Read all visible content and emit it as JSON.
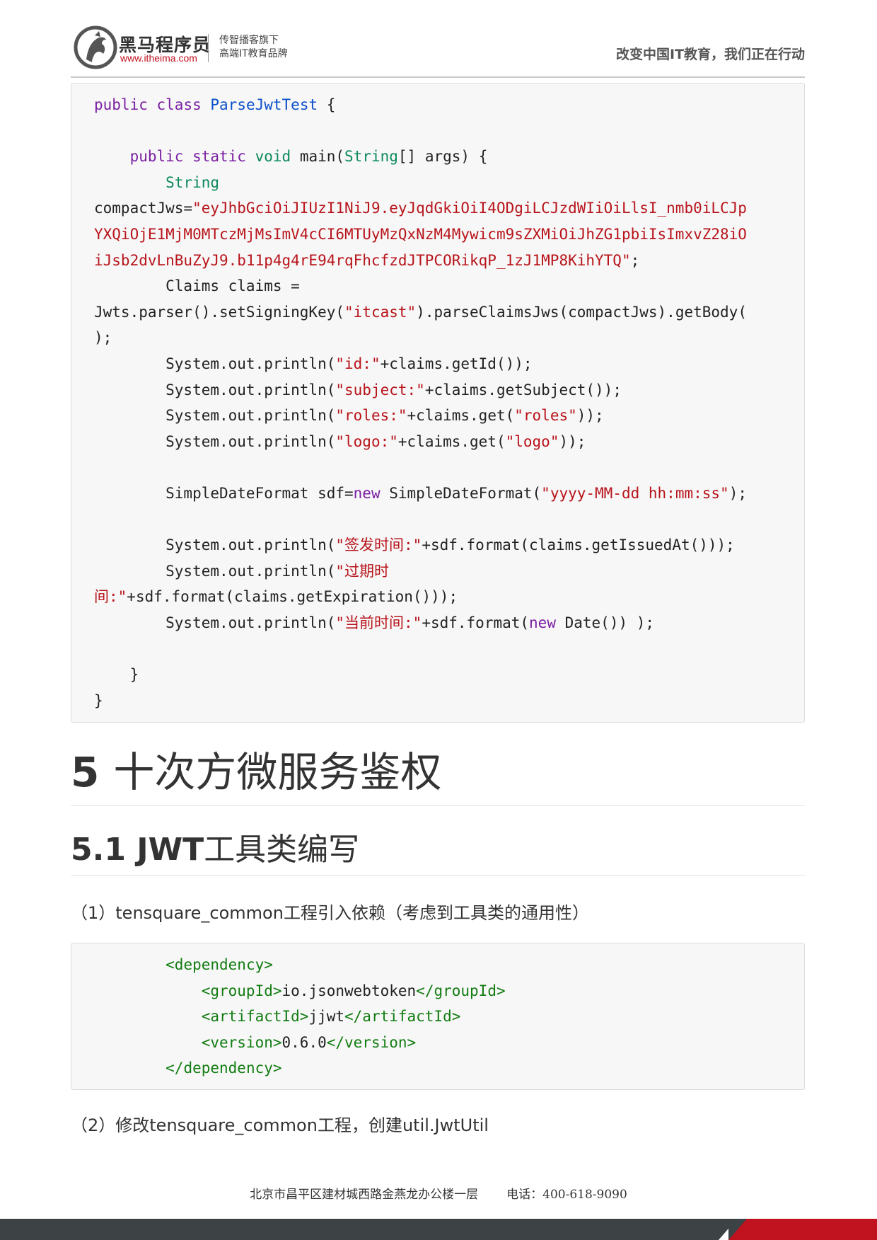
{
  "header": {
    "brand_name": "黑马程序员",
    "brand_url": "www.itheima.com",
    "tagline_line1": "传智播客旗下",
    "tagline_line2": "高端IT教育品牌",
    "slogan": "改变中国IT教育，我们正在行动"
  },
  "code_block_1": {
    "lines": [
      [
        {
          "c": "kw",
          "t": "public"
        },
        {
          "c": "",
          "t": " "
        },
        {
          "c": "kw",
          "t": "class"
        },
        {
          "c": "",
          "t": " "
        },
        {
          "c": "cls",
          "t": "ParseJwtTest"
        },
        {
          "c": "",
          "t": " {"
        }
      ],
      [],
      [
        {
          "c": "",
          "t": "    "
        },
        {
          "c": "kw",
          "t": "public"
        },
        {
          "c": "",
          "t": " "
        },
        {
          "c": "kw",
          "t": "static"
        },
        {
          "c": "",
          "t": " "
        },
        {
          "c": "tp",
          "t": "void"
        },
        {
          "c": "",
          "t": " main("
        },
        {
          "c": "tp",
          "t": "String"
        },
        {
          "c": "",
          "t": "[] args) {"
        }
      ],
      [
        {
          "c": "",
          "t": "        "
        },
        {
          "c": "tp",
          "t": "String"
        }
      ],
      [
        {
          "c": "",
          "t": "compactJws="
        },
        {
          "c": "st",
          "t": "\"eyJhbGciOiJIUzI1NiJ9.eyJqdGkiOiI4ODgiLCJzdWIiOiLlsI_nmb0iLCJp"
        }
      ],
      [
        {
          "c": "st",
          "t": "YXQiOjE1MjM0MTczMjMsImV4cCI6MTUyMzQxNzM4Mywicm9sZXMiOiJhZG1pbiIsImxvZ28iO"
        }
      ],
      [
        {
          "c": "st",
          "t": "iJsb2dvLnBuZyJ9.b11p4g4rE94rqFhcfzdJTPCORikqP_1zJ1MP8KihYTQ\""
        },
        {
          "c": "",
          "t": ";"
        }
      ],
      [
        {
          "c": "",
          "t": "        Claims claims ="
        }
      ],
      [
        {
          "c": "",
          "t": "Jwts.parser().setSigningKey("
        },
        {
          "c": "st",
          "t": "\"itcast\""
        },
        {
          "c": "",
          "t": ").parseClaimsJws(compactJws).getBody("
        }
      ],
      [
        {
          "c": "",
          "t": ");"
        }
      ],
      [
        {
          "c": "",
          "t": "        System.out.println("
        },
        {
          "c": "st",
          "t": "\"id:\""
        },
        {
          "c": "",
          "t": "+claims.getId());"
        }
      ],
      [
        {
          "c": "",
          "t": "        System.out.println("
        },
        {
          "c": "st",
          "t": "\"subject:\""
        },
        {
          "c": "",
          "t": "+claims.getSubject());"
        }
      ],
      [
        {
          "c": "",
          "t": "        System.out.println("
        },
        {
          "c": "st",
          "t": "\"roles:\""
        },
        {
          "c": "",
          "t": "+claims.get("
        },
        {
          "c": "st",
          "t": "\"roles\""
        },
        {
          "c": "",
          "t": "));"
        }
      ],
      [
        {
          "c": "",
          "t": "        System.out.println("
        },
        {
          "c": "st",
          "t": "\"logo:\""
        },
        {
          "c": "",
          "t": "+claims.get("
        },
        {
          "c": "st",
          "t": "\"logo\""
        },
        {
          "c": "",
          "t": "));"
        }
      ],
      [],
      [
        {
          "c": "",
          "t": "        SimpleDateFormat sdf="
        },
        {
          "c": "kw",
          "t": "new"
        },
        {
          "c": "",
          "t": " SimpleDateFormat("
        },
        {
          "c": "st",
          "t": "\"yyyy-MM-dd hh:mm:ss\""
        },
        {
          "c": "",
          "t": ");"
        }
      ],
      [],
      [
        {
          "c": "",
          "t": "        System.out.println("
        },
        {
          "c": "st",
          "t": "\"签发时间:\""
        },
        {
          "c": "",
          "t": "+sdf.format(claims.getIssuedAt()));"
        }
      ],
      [
        {
          "c": "",
          "t": "        System.out.println("
        },
        {
          "c": "st",
          "t": "\"过期时"
        }
      ],
      [
        {
          "c": "st",
          "t": "间:\""
        },
        {
          "c": "",
          "t": "+sdf.format(claims.getExpiration()));"
        }
      ],
      [
        {
          "c": "",
          "t": "        System.out.println("
        },
        {
          "c": "st",
          "t": "\"当前时间:\""
        },
        {
          "c": "",
          "t": "+sdf.format("
        },
        {
          "c": "kw",
          "t": "new"
        },
        {
          "c": "",
          "t": " Date()) );"
        }
      ],
      [],
      [
        {
          "c": "",
          "t": "    }"
        }
      ],
      [
        {
          "c": "",
          "t": "}"
        }
      ]
    ]
  },
  "section": {
    "h1_number": "5",
    "h1_title": "十次方微服务鉴权",
    "h2_number": "5.1 JWT",
    "h2_title": "工具类编写",
    "step1": "（1）tensquare_common工程引入依赖（考虑到工具类的通用性）",
    "step2": "（2）修改tensquare_common工程，创建util.JwtUtil"
  },
  "code_block_2": {
    "lines": [
      [
        {
          "c": "",
          "t": "        "
        },
        {
          "c": "tag",
          "t": "<dependency>"
        }
      ],
      [
        {
          "c": "",
          "t": "            "
        },
        {
          "c": "tag",
          "t": "<groupId>"
        },
        {
          "c": "",
          "t": "io.jsonwebtoken"
        },
        {
          "c": "tag",
          "t": "</groupId>"
        }
      ],
      [
        {
          "c": "",
          "t": "            "
        },
        {
          "c": "tag",
          "t": "<artifactId>"
        },
        {
          "c": "",
          "t": "jjwt"
        },
        {
          "c": "tag",
          "t": "</artifactId>"
        }
      ],
      [
        {
          "c": "",
          "t": "            "
        },
        {
          "c": "tag",
          "t": "<version>"
        },
        {
          "c": "",
          "t": "0.6.0"
        },
        {
          "c": "tag",
          "t": "</version>"
        }
      ],
      [
        {
          "c": "",
          "t": "        "
        },
        {
          "c": "tag",
          "t": "</dependency>"
        }
      ]
    ]
  },
  "footer": {
    "address": "北京市昌平区建材城西路金燕龙办公楼一层",
    "phone": "电话：400-618-9090"
  }
}
